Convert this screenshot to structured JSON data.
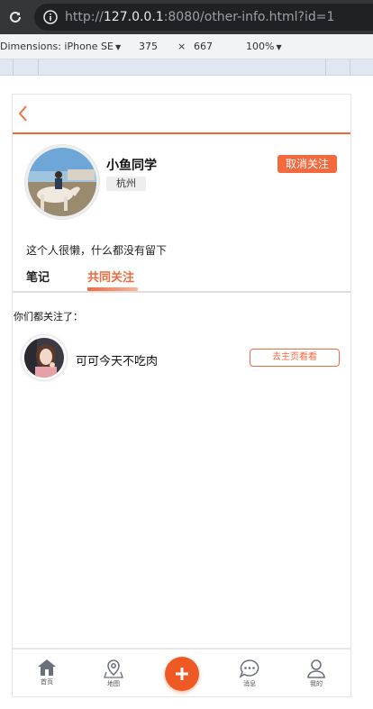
{
  "browser": {
    "url_prefix": "http://",
    "url_host": "127.0.0.1",
    "url_rest": ":8080/other-info.html?id=1",
    "devtools": {
      "device": "Dimensions: iPhone SE",
      "width": "375",
      "times": "×",
      "height": "667",
      "zoom": "100%"
    }
  },
  "header": {
    "back_icon": "chevron-left-icon"
  },
  "profile": {
    "username": "小鱼同学",
    "city": "杭州",
    "unfollow_label": "取消关注",
    "bio": "这个人很懒，什么都没有留下"
  },
  "tabs": [
    {
      "label": "笔记",
      "active": false
    },
    {
      "label": "共同关注",
      "active": true
    }
  ],
  "common_follow": {
    "heading": "你们都关注了：",
    "users": [
      {
        "name": "可可今天不吃肉",
        "button_label": "去主页看看"
      }
    ]
  },
  "bottom_nav": [
    {
      "label": "首页",
      "icon": "home-icon"
    },
    {
      "label": "地图",
      "icon": "map-pin-icon"
    },
    {
      "label": "",
      "icon": "plus-icon"
    },
    {
      "label": "消息",
      "icon": "chat-icon"
    },
    {
      "label": "我的",
      "icon": "user-icon"
    }
  ],
  "colors": {
    "accent": "#f26a3d",
    "fab": "#ef5a24",
    "chrome_dark": "#35363a"
  }
}
